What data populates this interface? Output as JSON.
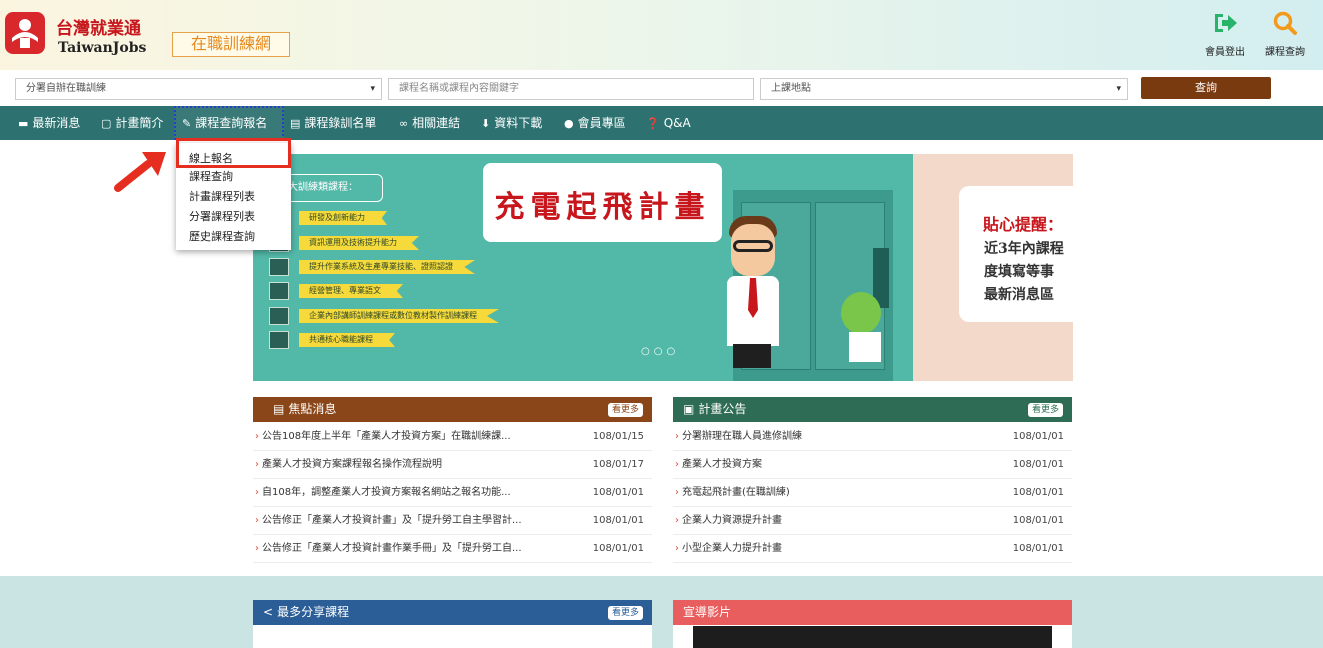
{
  "header": {
    "logo_cn": "台灣就業通",
    "logo_en": "TaiwanJobs",
    "site_badge": "在職訓練網",
    "logout_label": "會員登出",
    "course_search_label": "課程查詢",
    "accent_color": "#2d7270",
    "brand_red": "#c8161d"
  },
  "search": {
    "branch_value": "分署自辦在職訓練",
    "keyword_placeholder": "課程名稱或課程內容關鍵字",
    "place_value": "上課地點",
    "button_label": "查詢"
  },
  "nav": {
    "items": [
      {
        "label": "最新消息",
        "icon": "newspaper-icon"
      },
      {
        "label": "計畫簡介",
        "icon": "clipboard-icon"
      },
      {
        "label": "課程查詢報名",
        "icon": "pencil-icon"
      },
      {
        "label": "課程錄訓名單",
        "icon": "list-icon"
      },
      {
        "label": "相關連結",
        "icon": "link-icon"
      },
      {
        "label": "資料下載",
        "icon": "download-icon"
      },
      {
        "label": "會員專區",
        "icon": "user-icon"
      },
      {
        "label": "Q&A",
        "icon": "question-icon"
      }
    ]
  },
  "dropdown": {
    "items": [
      "線上報名",
      "課程查詢",
      "計畫課程列表",
      "分署課程列表",
      "歷史課程查詢"
    ]
  },
  "banner": {
    "title": "充電起飛計畫",
    "subtitle": "大訓練類課程：",
    "categories": [
      "研發及創新能力",
      "資訊運用及技術提升能力",
      "提升作業系統及生產專業技能、證照認證",
      "經營管理、專業語文",
      "企業內部講師訓練課程或數位教材製作訓練課程",
      "共通核心職能課程"
    ],
    "reminder_title": "貼心提醒：",
    "reminder_lines": [
      "近3年內課程",
      "度填寫等事",
      "最新消息區"
    ]
  },
  "news": {
    "title": "焦點消息",
    "more_label": "看更多",
    "rows": [
      {
        "text": "公告108年度上半年「產業人才投資方案」在職訓練課...",
        "date": "108/01/15"
      },
      {
        "text": "產業人才投資方案課程報名操作流程說明",
        "date": "108/01/17"
      },
      {
        "text": "自108年，調整產業人才投資方案報名網站之報名功能...",
        "date": "108/01/01"
      },
      {
        "text": "公告修正「產業人才投資計畫」及「提升勞工自主學習計...",
        "date": "108/01/01"
      },
      {
        "text": "公告修正「產業人才投資計畫作業手冊」及「提升勞工自...",
        "date": "108/01/01"
      }
    ]
  },
  "announcements": {
    "title": "計畫公告",
    "more_label": "看更多",
    "rows": [
      {
        "text": "分署辦理在職人員進修訓練",
        "date": "108/01/01"
      },
      {
        "text": "產業人才投資方案",
        "date": "108/01/01"
      },
      {
        "text": "充電起飛計畫(在職訓練)",
        "date": "108/01/01"
      },
      {
        "text": "企業人力資源提升計畫",
        "date": "108/01/01"
      },
      {
        "text": "小型企業人力提升計畫",
        "date": "108/01/01"
      }
    ]
  },
  "share": {
    "title": "最多分享課程",
    "more_label": "看更多"
  },
  "video": {
    "title": "宣導影片"
  }
}
